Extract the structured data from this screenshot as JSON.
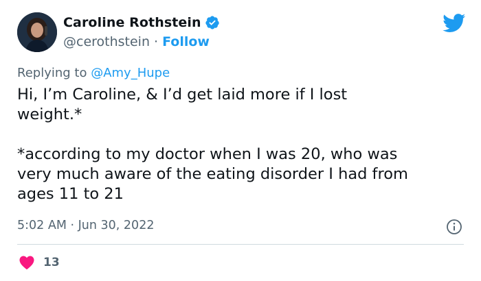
{
  "author": {
    "display_name": "Caroline Rothstein",
    "handle": "@cerothstein",
    "separator": "·",
    "follow_label": "Follow"
  },
  "reply": {
    "prefix": "Replying to ",
    "to_handle": "@Amy_Hupe"
  },
  "tweet": {
    "text": "Hi, I’m Caroline, & I’d get laid more if I lost\nweight.*\n\n*according to my doctor when I was 20, who was\nvery much aware of the eating disorder I had from\nages 11 to 21"
  },
  "meta": {
    "timestamp": "5:02 AM · Jun 30, 2022"
  },
  "engagement": {
    "likes": "13"
  },
  "colors": {
    "accent": "#1d9bf0",
    "like": "#f91880",
    "muted": "#536471",
    "text": "#0f1419"
  },
  "icons": {
    "verified": "verified-badge-icon",
    "logo": "twitter-bird-icon",
    "info": "info-icon",
    "like": "heart-icon"
  }
}
